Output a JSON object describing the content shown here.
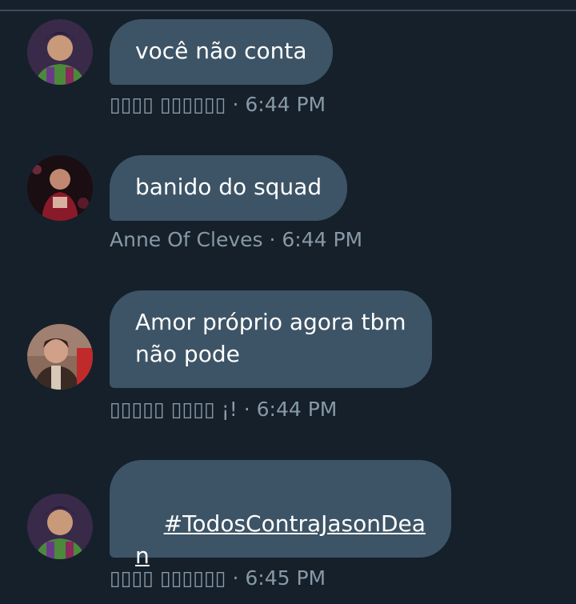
{
  "messages": [
    {
      "text": "você não conta",
      "sender": "▯▯▯▯ ▯▯▯▯▯▯",
      "separator": " · ",
      "time": "6:44 PM",
      "avatar_icon": "user-avatar-icon"
    },
    {
      "text": "banido do squad",
      "sender": "Anne Of Cleves",
      "separator": " · ",
      "time": "6:44 PM",
      "avatar_icon": "user-avatar-icon"
    },
    {
      "text": "Amor próprio agora tbm\nnão pode",
      "sender": "▯▯▯▯▯ ▯▯▯▯ ¡!",
      "separator": " · ",
      "time": "6:44 PM",
      "avatar_icon": "user-avatar-icon"
    },
    {
      "text": "#TodosContraJasonDea\nn",
      "sender": "▯▯▯▯ ▯▯▯▯▯▯",
      "separator": " · ",
      "time": "6:45 PM",
      "avatar_icon": "user-avatar-icon"
    }
  ],
  "colors": {
    "background": "#15202b",
    "bubble": "#3d5466",
    "meta_text": "#8899a6",
    "message_text": "#ffffff"
  }
}
